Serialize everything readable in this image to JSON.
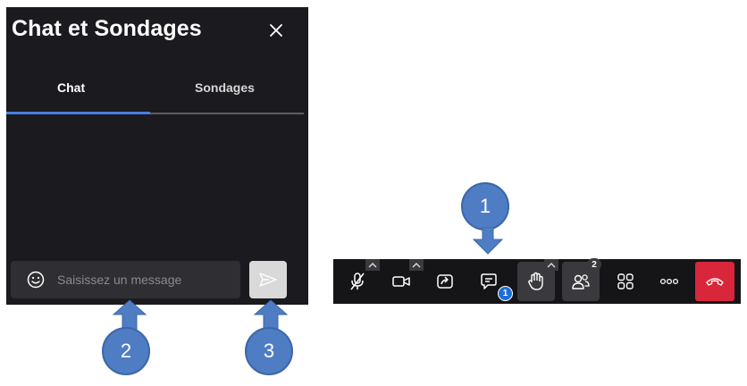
{
  "panel": {
    "title": "Chat et Sondages",
    "tabs": [
      {
        "label": "Chat",
        "active": true
      },
      {
        "label": "Sondages",
        "active": false
      }
    ],
    "message_placeholder": "Saisissez un message"
  },
  "toolbar": {
    "buttons": [
      {
        "name": "mic-muted",
        "icon": "mic-off-icon",
        "has_menu": true
      },
      {
        "name": "camera",
        "icon": "video-camera-icon",
        "has_menu": true
      },
      {
        "name": "share-screen",
        "icon": "share-screen-icon"
      },
      {
        "name": "chat",
        "icon": "chat-bubble-icon",
        "badge": "1"
      },
      {
        "name": "raise-hand",
        "icon": "hand-icon",
        "has_menu": true
      },
      {
        "name": "participants",
        "icon": "participants-icon",
        "badge": "2"
      },
      {
        "name": "tile-view",
        "icon": "grid-icon"
      },
      {
        "name": "more",
        "icon": "more-dots-icon"
      },
      {
        "name": "leave",
        "icon": "hang-up-icon"
      }
    ],
    "chat_badge": "1",
    "participants_count": "2"
  },
  "callouts": {
    "one": "1",
    "two": "2",
    "three": "3"
  },
  "colors": {
    "panel_bg": "#1b1a1f",
    "accent": "#4a7de0",
    "toolbar_bg": "#151518",
    "hangup": "#d9263a",
    "callout": "#4f7dc3",
    "badge": "#1f6ed4"
  }
}
